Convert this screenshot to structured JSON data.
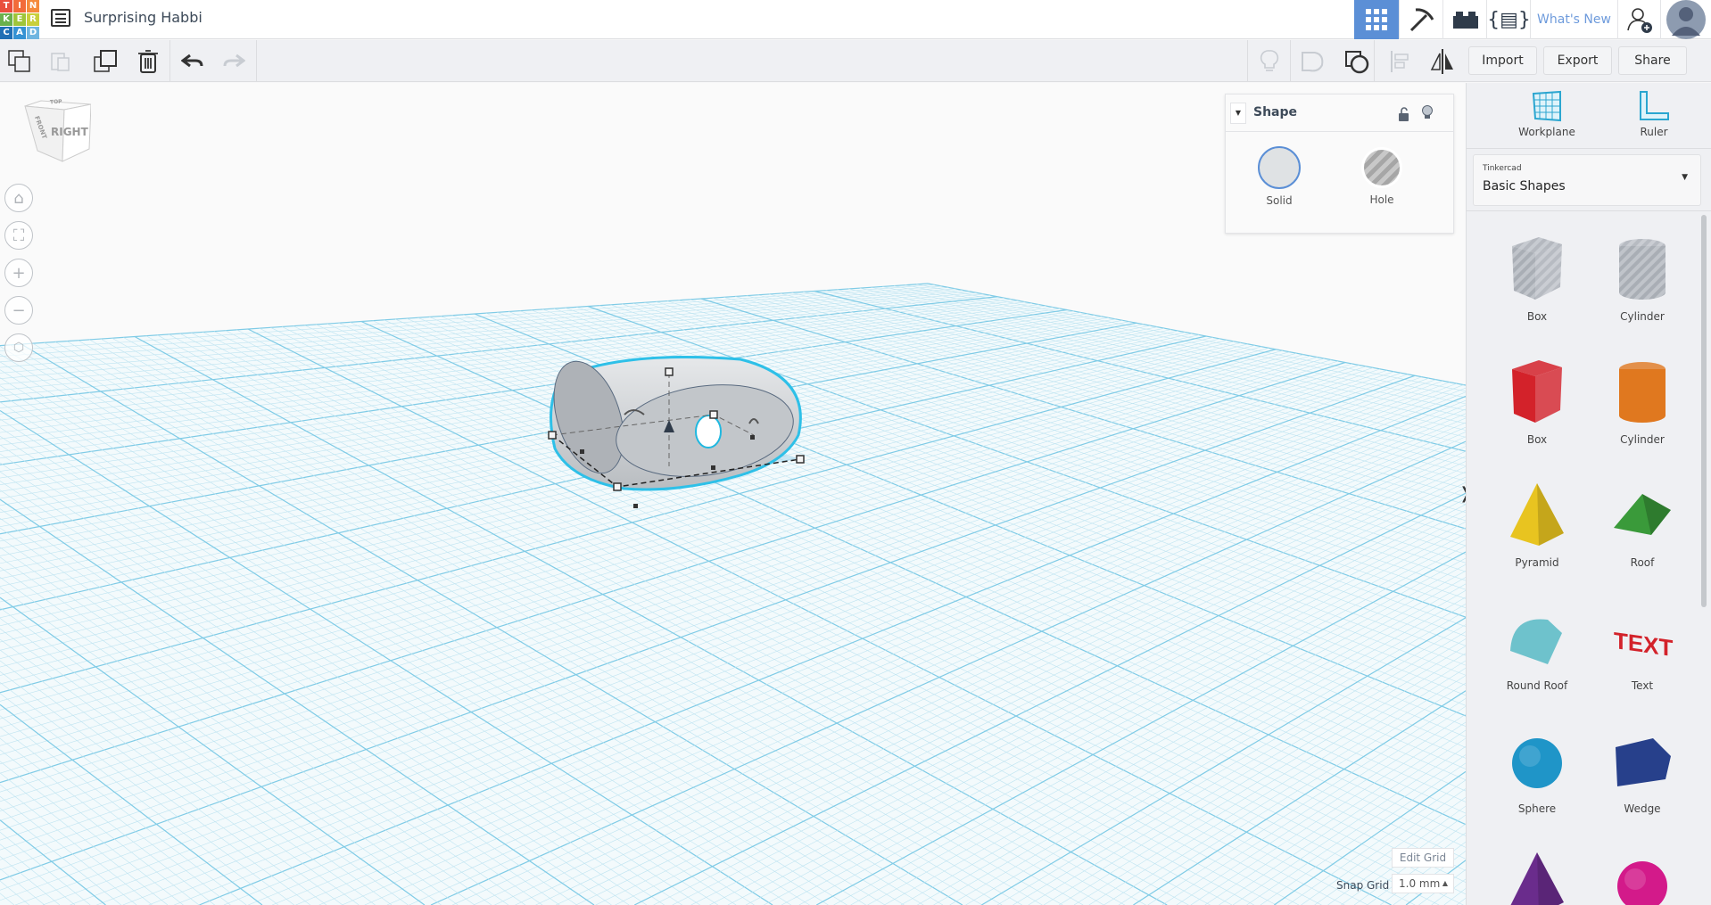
{
  "app": {
    "logo_letters": [
      "T",
      "I",
      "N",
      "K",
      "E",
      "R",
      "C",
      "A",
      "D"
    ],
    "logo_colors": [
      "#e94e3c",
      "#f26b3a",
      "#f58a3c",
      "#6ab04c",
      "#9fc53a",
      "#c9cf3b",
      "#1f6fb5",
      "#3592d3",
      "#6fb5e0"
    ],
    "title": "Surprising Habbi"
  },
  "topnav": {
    "whats_new": "What's New",
    "active_icon": "grid-view-icon",
    "icons": [
      "grid-view-icon",
      "pickaxe-icon",
      "bricks-icon",
      "codeblocks-icon",
      "add-user-icon",
      "avatar"
    ]
  },
  "toolbar": {
    "import": "Import",
    "export": "Export",
    "share": "Share"
  },
  "viewcube": {
    "front_face": "RIGHT",
    "side_face": "FRONT",
    "top_face": "TOP"
  },
  "inspector": {
    "title": "Shape",
    "solid": "Solid",
    "hole": "Hole",
    "selected": "Solid"
  },
  "library": {
    "workplane": "Workplane",
    "ruler": "Ruler",
    "source": "Tinkercad",
    "category": "Basic Shapes",
    "shapes": [
      {
        "name": "Box",
        "color": "#b4b9c0"
      },
      {
        "name": "Cylinder",
        "color": "#b4b9c0"
      },
      {
        "name": "Box",
        "color": "#d3222a"
      },
      {
        "name": "Cylinder",
        "color": "#e0781f"
      },
      {
        "name": "Pyramid",
        "color": "#e8c420"
      },
      {
        "name": "Roof",
        "color": "#3a9a3a"
      },
      {
        "name": "Round Roof",
        "color": "#6ec2cc"
      },
      {
        "name": "Text",
        "color": "#d3222a"
      },
      {
        "name": "Sphere",
        "color": "#1f95c8"
      },
      {
        "name": "Wedge",
        "color": "#27408b"
      },
      {
        "name": "",
        "color": "#6a2c8c"
      },
      {
        "name": "",
        "color": "#d31a8a"
      }
    ]
  },
  "grid": {
    "edit_grid": "Edit Grid",
    "snap_grid_label": "Snap Grid",
    "snap_grid_value": "1.0 mm"
  }
}
